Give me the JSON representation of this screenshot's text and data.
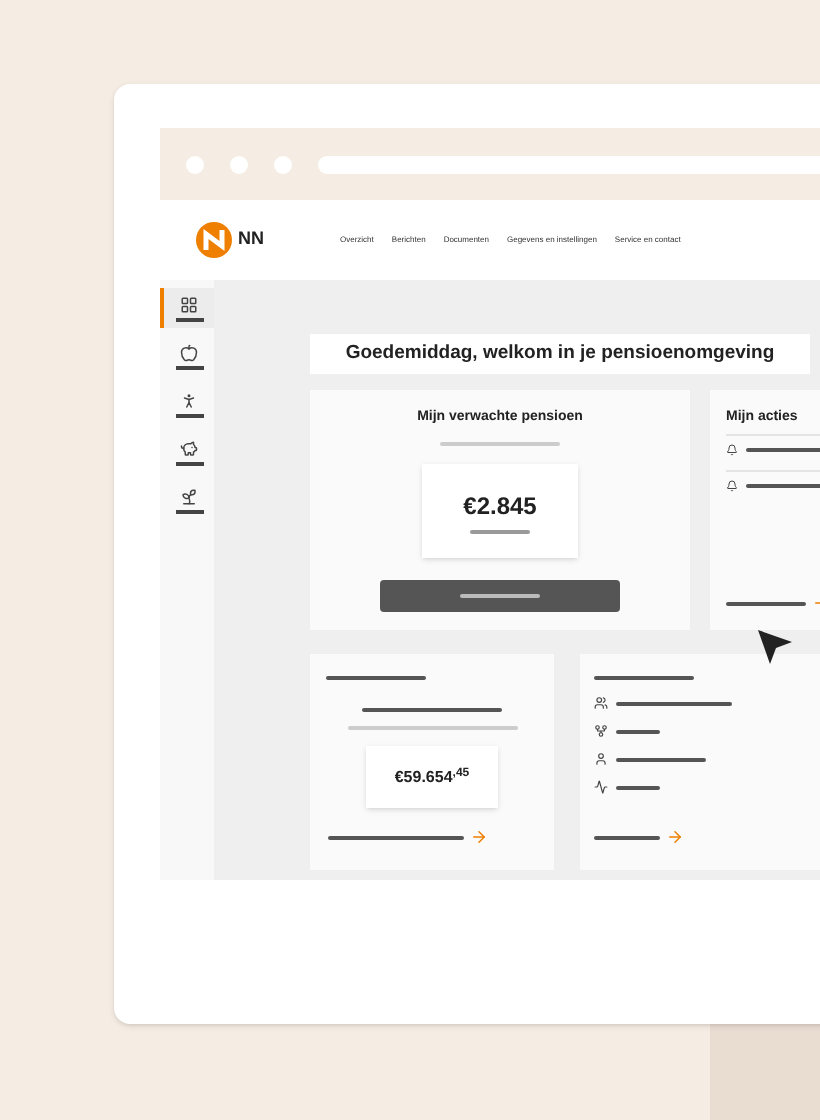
{
  "header": {
    "logo_text": "NN",
    "nav": [
      "Overzicht",
      "Berichten",
      "Documenten",
      "Gegevens en instellingen",
      "Service en contact"
    ]
  },
  "sidebar": {
    "items": [
      {
        "selected": true
      },
      {
        "selected": false
      },
      {
        "selected": false
      },
      {
        "selected": false
      },
      {
        "selected": false
      }
    ]
  },
  "greeting": "Goedemiddag, welkom in je pensioenomgeving",
  "pension_card": {
    "title": "Mijn verwachte pensioen",
    "amount": "€2.845"
  },
  "actions_card": {
    "title": "Mijn acties"
  },
  "savings_card": {
    "amount": "€59.654$^{,45}$"
  }
}
